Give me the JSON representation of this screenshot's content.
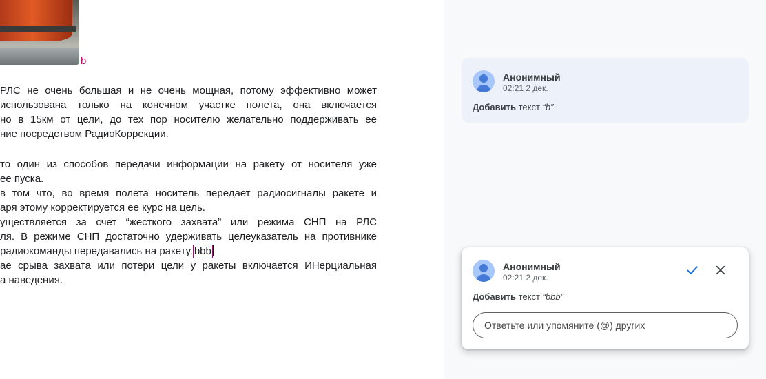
{
  "document": {
    "image_suggestion_mark": "b",
    "paragraphs": [
      {
        "lines": [
          "РЛС не очень большая и не очень мощная,  потому эффективно может",
          "использована только на конечном участке полета, она включается",
          "но в 15км от цели,  до тех пор носителю желательно поддерживать ее",
          "ние посредством РадиоКоррекции."
        ]
      },
      {
        "lines": [
          "то один из способов передачи информации на ракету от носителя уже",
          "ее пуска.",
          "в том что,  во время полета носитель передает радиосигналы ракете и",
          "аря этому корректируется ее курс на цель.",
          "уществляется за счет “жесткого захвата” или режима СНП на РЛС",
          "ля. В режиме СНП достаточно удерживать целеуказатель на противнике",
          "радиокоманды передавались на ракету.",
          "ае срыва захвата или потери цели у ракеты включается ИНерциальная",
          "а наведения."
        ],
        "inline_suggestion": "bbb"
      }
    ]
  },
  "comments": [
    {
      "author": "Анонимный",
      "time": "02:21 2 дек.",
      "action_verb": "Добавить",
      "action_text": "текст",
      "action_value": "“b”"
    },
    {
      "author": "Анонимный",
      "time": "02:21 2 дек.",
      "action_verb": "Добавить",
      "action_text": "текст",
      "action_value": "“bbb”",
      "accept_icon": "checkmark-icon",
      "reject_icon": "close-icon",
      "reply_placeholder": "Ответьте или упомяните (@) других"
    }
  ],
  "colors": {
    "suggestion": "#b0136e",
    "accept": "#1a73e8",
    "inactive_card": "#edf2fa"
  }
}
